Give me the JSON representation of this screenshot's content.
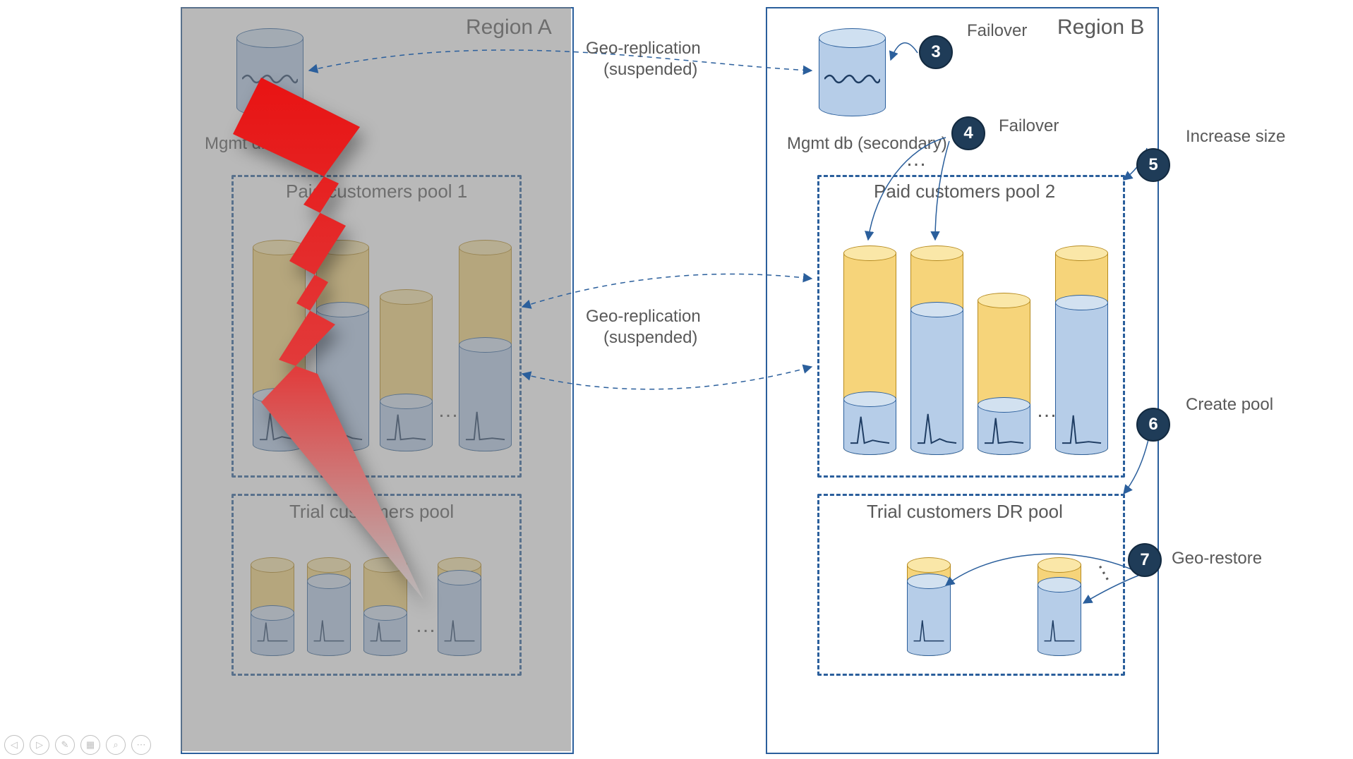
{
  "regionA": {
    "title": "Region A",
    "mgmt_label": "Mgmt db (primary)",
    "pool1_title": "Paid customers pool 1",
    "trial_title": "Trial customers pool"
  },
  "regionB": {
    "title": "Region B",
    "mgmt_label": "Mgmt db (secondary)",
    "pool2_title": "Paid customers pool 2",
    "drpool_title": "Trial customers DR pool"
  },
  "arrows": {
    "geo1": "Geo-replication",
    "geo1_sub": "(suspended)",
    "geo2": "Geo-replication",
    "geo2_sub": "(suspended)"
  },
  "steps": {
    "s3": {
      "num": "3",
      "label": "Failover"
    },
    "s4": {
      "num": "4",
      "label": "Failover"
    },
    "s5": {
      "num": "5",
      "label": "Increase size"
    },
    "s6": {
      "num": "6",
      "label": "Create pool"
    },
    "s7": {
      "num": "7",
      "label": "Geo-restore"
    }
  },
  "misc": {
    "ellipsis": "…"
  },
  "toolbar": {
    "prev": "◁",
    "next": "▷",
    "pen": "✎",
    "all": "▦",
    "zoom": "⌕",
    "more": "⋯"
  }
}
